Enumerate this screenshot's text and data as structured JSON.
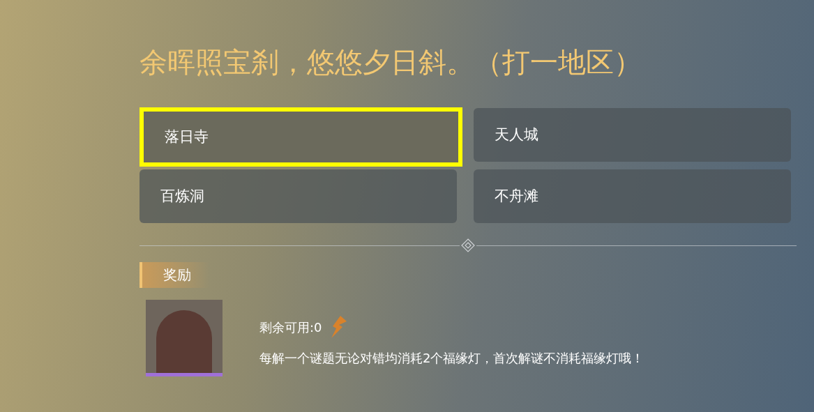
{
  "question": "余晖照宝刹，悠悠夕日斜。（打一地区）",
  "options": [
    {
      "label": "落日寺",
      "selected": true
    },
    {
      "label": "天人城",
      "selected": false
    },
    {
      "label": "百炼洞",
      "selected": false
    },
    {
      "label": "不舟滩",
      "selected": false
    }
  ],
  "reward": {
    "heading": "奖励",
    "remaining": "剩余可用:0",
    "note": "每解一个谜题无论对错均消耗2个福缘灯，首次解谜不消耗福缘灯哦！"
  }
}
